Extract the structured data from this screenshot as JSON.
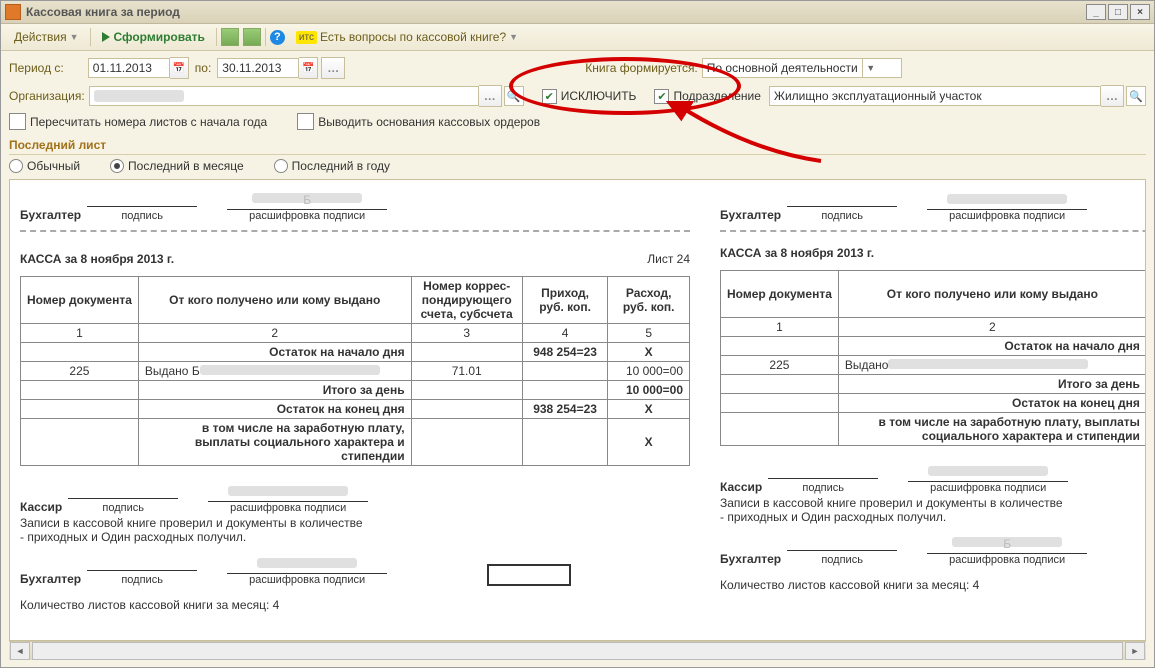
{
  "title": "Кассовая книга за период",
  "toolbar": {
    "actions": "Действия",
    "form": "Сформировать",
    "help_link": "Есть вопросы по кассовой книге?",
    "its": "итс"
  },
  "period": {
    "label": "Период с:",
    "from": "01.11.2013",
    "to_lbl": "по:",
    "to": "30.11.2013"
  },
  "org": {
    "label": "Организация:"
  },
  "book": {
    "label": "Книга формируется:",
    "value": "По основной деятельности"
  },
  "exclude": "ИСКЛЮЧИТЬ",
  "subdiv_lbl": "Подразделение",
  "subdiv_val": "Жилищно эксплуатационный участок",
  "recount": "Пересчитать номера листов с начала года",
  "output": "Выводить основания кассовых ордеров",
  "lastsheet": {
    "title": "Последний лист",
    "o1": "Обычный",
    "o2": "Последний в месяце",
    "o3": "Последний в году"
  },
  "signs": {
    "buh": "Бухгалтер",
    "cashier": "Кассир",
    "sign": "подпись",
    "decode": "расшифровка подписи"
  },
  "kassa_title": "КАССА за 8 ноября 2013 г.",
  "sheet": "Лист 24",
  "headers": {
    "num": "Номер документа",
    "who": "От кого получено или кому выдано",
    "corr": "Номер коррес-\nпондирующего счета, субсчета",
    "corr2": "Номер кор\nпондирую\nсчета, суб",
    "in": "Приход,\nруб. коп.",
    "out": "Расход,\nруб. коп."
  },
  "nums": {
    "c1": "1",
    "c2": "2",
    "c3": "3",
    "c4": "4",
    "c5": "5"
  },
  "rows": {
    "start": "Остаток на начало дня",
    "start_in": "948 254=23",
    "start_out": "Х",
    "r1_num": "225",
    "r1_who": "Выдано Б",
    "r1_who2": "Выдано",
    "r1_corr": "71.01",
    "r1_out": "10 000=00",
    "total": "Итого за день",
    "total_out": "10 000=00",
    "end": "Остаток на конец  дня",
    "end_in": "938 254=23",
    "end_out": "Х",
    "extra": "в том числе на заработную плату, выплаты социального характера и стипендии",
    "extra_out": "Х"
  },
  "footer": {
    "check": "Записи в кассовой книге проверил и документы в количестве",
    "check2": "- приходных и Один расходных получил.",
    "count": "Количество листов кассовой книги за месяц: 4"
  }
}
